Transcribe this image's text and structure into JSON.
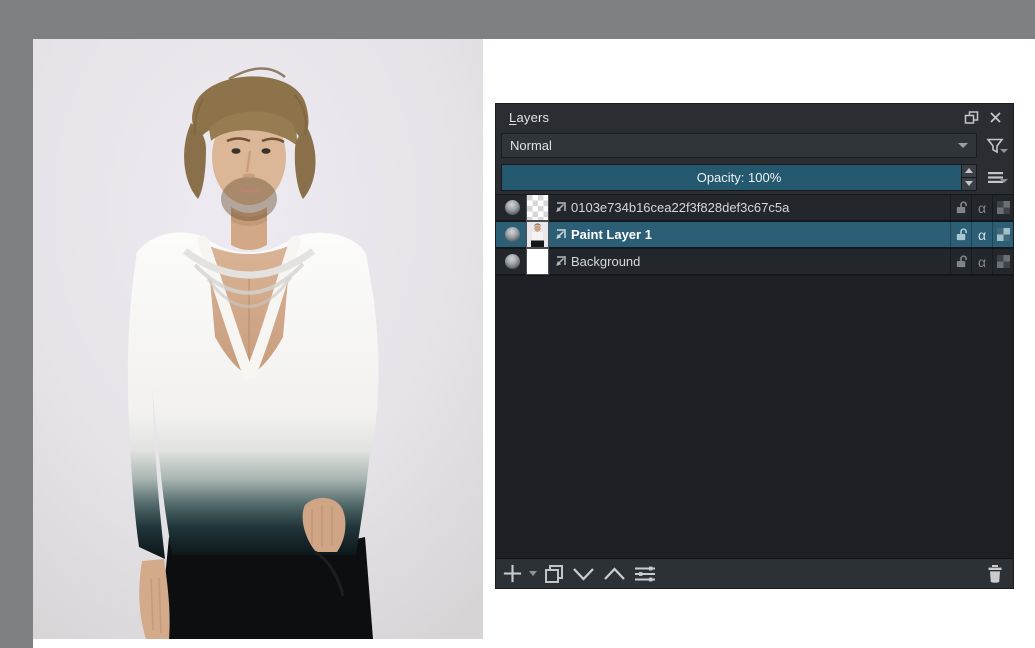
{
  "layers_panel": {
    "title_mnemonic": "L",
    "title_rest": "ayers",
    "blend_mode": "Normal",
    "opacity_display": "Opacity:  100%",
    "alpha_glyph": "α",
    "layers": [
      {
        "name": "0103e734b16cea22f3f828def3c67c5a",
        "selected": false,
        "visible": true,
        "thumbnail": "transparent-checker"
      },
      {
        "name": "Paint Layer 1",
        "selected": true,
        "visible": true,
        "thumbnail": "photo-miniature"
      },
      {
        "name": "Background",
        "selected": false,
        "visible": true,
        "thumbnail": "solid-white"
      }
    ],
    "colors": {
      "panel_background": "#2a2e33",
      "list_background": "#1d2125",
      "selection_teal": "#2c5f76",
      "opacity_fill_teal": "#24586e",
      "text_light": "#dfe2e4"
    }
  },
  "canvas": {
    "surround_gray": "#7f8082",
    "canvas_white": "#ffffff",
    "photo_background": "#e8e6eb",
    "shirt_dark_dip": "#0c1417"
  }
}
